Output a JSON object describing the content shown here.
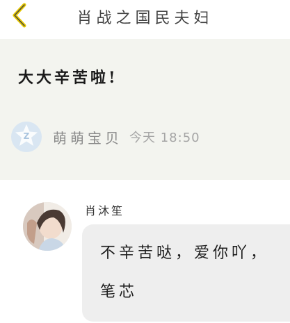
{
  "header": {
    "title": "肖战之国民夫妇",
    "back_icon": "chevron-left-icon",
    "accent_color": "#e6c800"
  },
  "post": {
    "text": "大大辛苦啦!",
    "author": {
      "name": "萌萌宝贝",
      "avatar_icon": "letter-z-star-icon",
      "avatar_color": "#d9e6f2"
    },
    "time": "今天 18:50"
  },
  "reply": {
    "author": {
      "name": "肖沐笙",
      "avatar": "user-photo"
    },
    "text": "不辛苦哒，爱你吖，笔芯"
  }
}
